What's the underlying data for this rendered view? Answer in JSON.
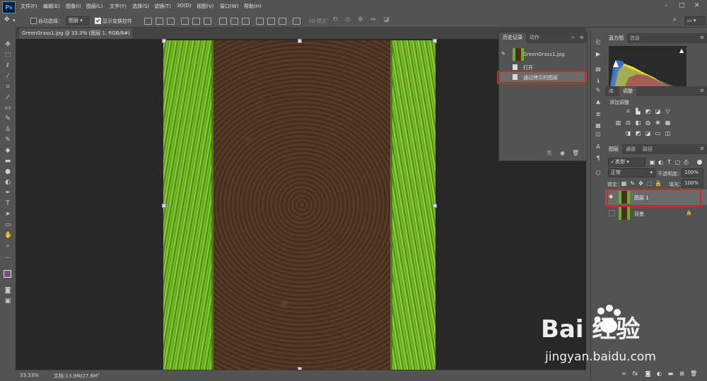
{
  "app": {
    "logo": "Ps"
  },
  "menu": [
    "文件(F)",
    "编辑(E)",
    "图像(I)",
    "图层(L)",
    "文字(Y)",
    "选择(S)",
    "滤镜(T)",
    "3D(D)",
    "视图(V)",
    "窗口(W)",
    "帮助(H)"
  ],
  "options": {
    "auto_select_label": "自动选择：",
    "auto_select_value": "图层",
    "show_transform_label": "显示变换控件",
    "mode_3d_label": "3D 模式："
  },
  "document": {
    "tab_title": "GreenGrass1.jpg @ 33.3% (图层 1, RGB/8#) *"
  },
  "status": {
    "zoom": "33.33%",
    "doc_size": "文档:13.9M/27.8M"
  },
  "history_panel": {
    "tabs": [
      "历史记录",
      "动作"
    ],
    "snapshot": "GreenGrass1.jpg",
    "items": [
      "打开",
      "通过拷贝的图层"
    ]
  },
  "histogram_panel": {
    "tabs": [
      "直方图",
      "信息"
    ]
  },
  "adjust_panel": {
    "tabs": [
      "库",
      "调整"
    ],
    "title": "添加调整"
  },
  "layers_panel": {
    "tabs": [
      "图层",
      "通道",
      "路径"
    ],
    "filter_value": "类型",
    "blend_mode": "正常",
    "opacity_label": "不透明度：",
    "opacity_value": "100%",
    "lock_label": "锁定：",
    "fill_label": "填充：",
    "fill_value": "100%",
    "layers": [
      {
        "name": "图层 1"
      },
      {
        "name": "背景"
      }
    ]
  },
  "watermark": {
    "logo": "Bai 经验",
    "url": "jingyan.baidu.com"
  },
  "colors": {
    "highlight": "#d8232a",
    "ps_blue": "#31a8ff",
    "panel_bg": "#535353",
    "canvas_bg": "#282828"
  }
}
